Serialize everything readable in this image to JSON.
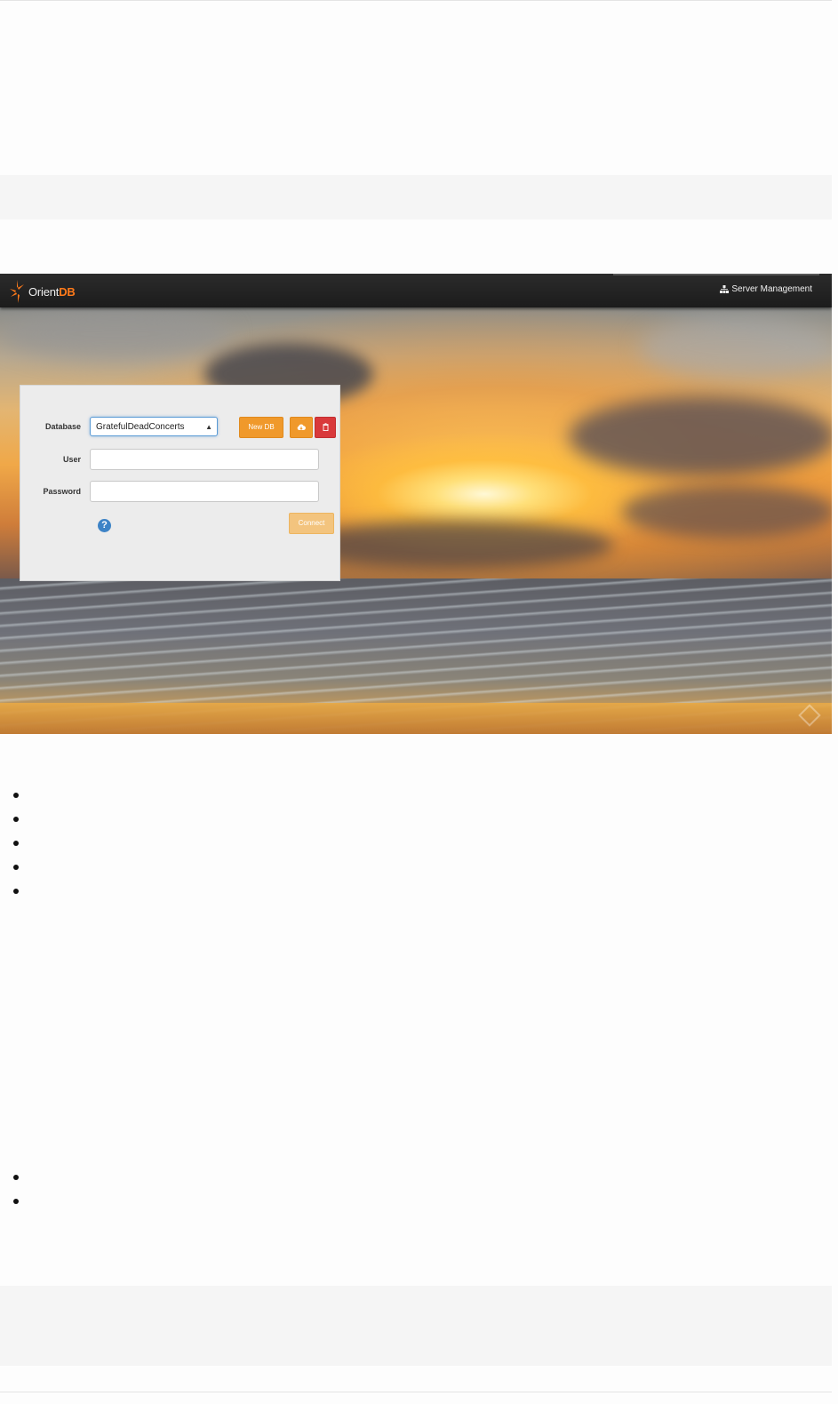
{
  "navbar": {
    "logo_prefix": "Orient",
    "logo_suffix": "DB",
    "server_management_label": "Server Management"
  },
  "login": {
    "database_label": "Database",
    "database_value": "GratefulDeadConcerts",
    "new_db_label": "New DB",
    "user_label": "User",
    "user_value": "",
    "password_label": "Password",
    "password_value": "",
    "connect_label": "Connect",
    "help_glyph": "?"
  },
  "icons": {
    "logo": "orientdb-logo-icon",
    "server": "sitemap-icon",
    "import": "cloud-download-icon",
    "delete": "trash-icon",
    "help": "question-circle-icon",
    "corner": "corner-badge-icon"
  },
  "colors": {
    "navbar_bg": "#1c1c1c",
    "logo_accent": "#ff7a1a",
    "new_db_button": "#f0992b",
    "delete_button": "#d9393b",
    "connect_button": "#f3c47e",
    "help_icon": "#3d83c6",
    "select_focus": "#5b9bd5"
  }
}
